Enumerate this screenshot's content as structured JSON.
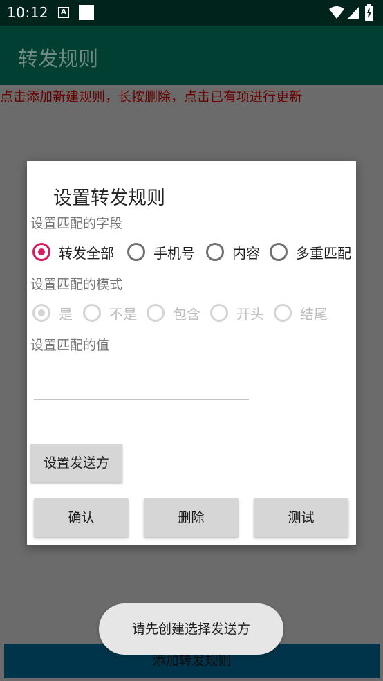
{
  "status_bar": {
    "time": "10:12",
    "notification_icon_letter": "A"
  },
  "app_bar": {
    "title": "转发规则"
  },
  "hint": "点击添加新建规则，长按删除，点击已有项进行更新",
  "add_button_label": "添加转发规则",
  "dialog": {
    "title": "设置转发规则",
    "field_label": "设置匹配的字段",
    "field_options": [
      {
        "label": "转发全部",
        "checked": true
      },
      {
        "label": "手机号",
        "checked": false
      },
      {
        "label": "内容",
        "checked": false
      },
      {
        "label": "多重匹配",
        "checked": false
      }
    ],
    "mode_label": "设置匹配的模式",
    "mode_options": [
      {
        "label": "是",
        "checked": true
      },
      {
        "label": "不是",
        "checked": false
      },
      {
        "label": "包含",
        "checked": false
      },
      {
        "label": "开头",
        "checked": false
      },
      {
        "label": "结尾",
        "checked": false
      }
    ],
    "value_label": "设置匹配的值",
    "value_input": {
      "value": "",
      "placeholder": ""
    },
    "set_sender_label": "设置发送方",
    "confirm_label": "确认",
    "delete_label": "删除",
    "test_label": "测试"
  },
  "toast": "请先创建选择发送方",
  "colors": {
    "accent": "#d81b60",
    "app_bar": "#003f32",
    "status_bar": "#00241b",
    "hint_text": "#6b0000"
  }
}
